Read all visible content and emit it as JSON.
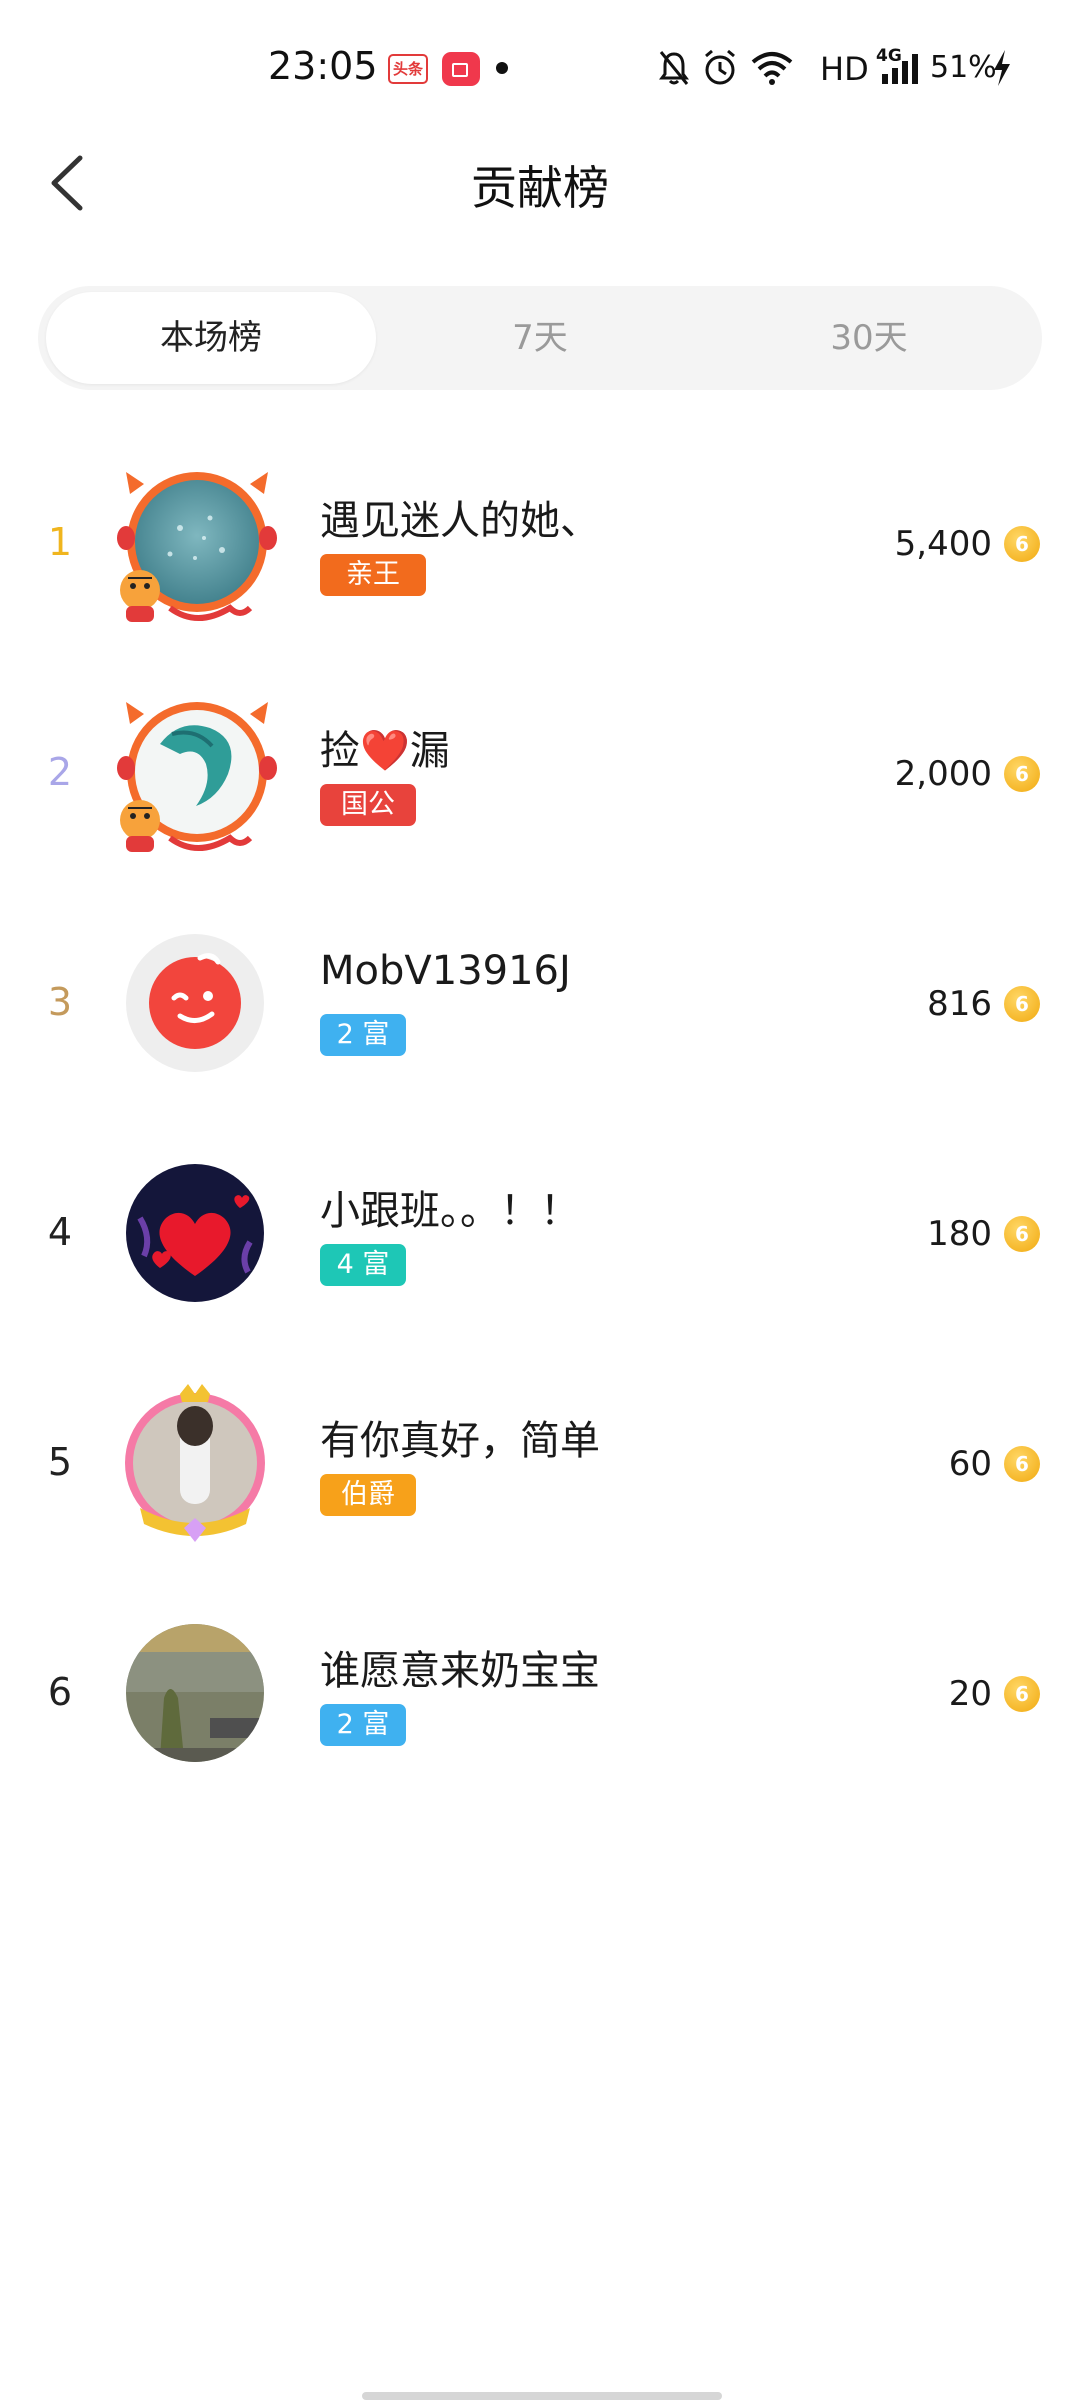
{
  "status_bar": {
    "time": "23:05",
    "toutiao_label": "头条",
    "network_label": "HD",
    "cell_label": "4G",
    "battery_label": "51%",
    "icons": [
      "toutiao-icon",
      "video-icon",
      "mute-bell-icon",
      "alarm-icon",
      "wifi-icon",
      "signal-icon",
      "charging-icon"
    ]
  },
  "header": {
    "title": "贡献榜"
  },
  "tabs": [
    {
      "label": "本场榜",
      "active": true
    },
    {
      "label": "7天",
      "active": false
    },
    {
      "label": "30天",
      "active": false
    }
  ],
  "ranking": [
    {
      "rank": "1",
      "name": "遇见迷人的她、",
      "badge": "亲王",
      "score": "5,400"
    },
    {
      "rank": "2",
      "name": "捡❤️漏",
      "badge": "国公",
      "score": "2,000"
    },
    {
      "rank": "3",
      "name": "MobV13916J",
      "badge": "2 富",
      "score": "816"
    },
    {
      "rank": "4",
      "name": "小跟班。。！！",
      "badge": "4 富",
      "score": "180"
    },
    {
      "rank": "5",
      "name": "有你真好，简单",
      "badge": "伯爵",
      "score": "60"
    },
    {
      "rank": "6",
      "name": "谁愿意来奶宝宝",
      "badge": "2 富",
      "score": "20"
    }
  ],
  "colors": {
    "rank_1": "#f0b51e",
    "rank_2": "#a9a6e8",
    "rank_3": "#c49a5c",
    "rank_other": "#222222",
    "badge_qinwang": "#f26b1d",
    "badge_guogong": "#e8433c",
    "badge_fu_blue": "#3fb1f0",
    "badge_fu_teal": "#1ec7b6",
    "badge_bojue": "#f7a11a",
    "coin": "#f1a90f"
  },
  "coin_glyph": "6"
}
